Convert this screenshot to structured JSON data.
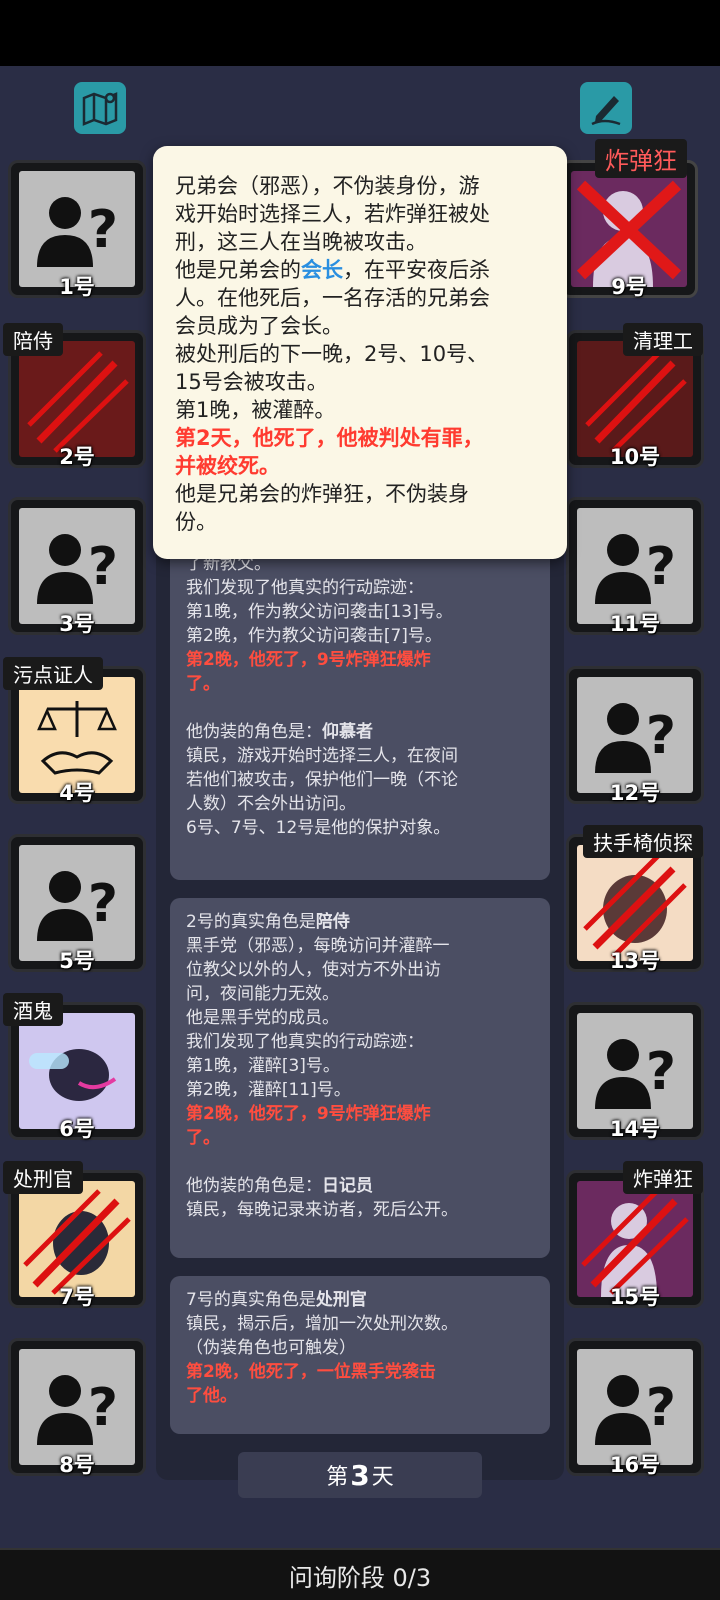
{
  "slots": {
    "s1": {
      "num": "1号"
    },
    "s2": {
      "num": "2号",
      "role": "陪侍"
    },
    "s3": {
      "num": "3号"
    },
    "s4": {
      "num": "4号",
      "role": "污点证人"
    },
    "s5": {
      "num": "5号"
    },
    "s6": {
      "num": "6号",
      "role": "酒鬼"
    },
    "s7": {
      "num": "7号",
      "role": "处刑官"
    },
    "s8": {
      "num": "8号"
    },
    "s9": {
      "num": "9号",
      "role": "炸弹狂"
    },
    "s10": {
      "num": "10号",
      "role": "清理工"
    },
    "s11": {
      "num": "11号"
    },
    "s12": {
      "num": "12号"
    },
    "s13": {
      "num": "13号",
      "role": "扶手椅侦探"
    },
    "s14": {
      "num": "14号"
    },
    "s15": {
      "num": "15号",
      "role": "炸弹狂"
    },
    "s16": {
      "num": "16号"
    }
  },
  "popup": {
    "l1": "兄弟会（邪恶），不伪装身份，游",
    "l2": "戏开始时选择三人，若炸弹狂被处",
    "l3": "刑，这三人在当晚被攻击。",
    "l4a": "他是兄弟会的",
    "l4b": "会长",
    "l4c": "，在平安夜后杀",
    "l5": "人。在他死后，一名存活的兄弟会",
    "l6": "会员成为了会长。",
    "l7": "被处刑后的下一晚，2号、10号、",
    "l8": "15号会被攻击。",
    "l9": "第1晚，被灌醉。",
    "l10": "第2天，他死了，他被判处有罪，",
    "l11": "并被绞死。",
    "l12": "他是兄弟会的炸弹狂，不伪装身",
    "l13": "份。"
  },
  "card1": {
    "l1": "了新教父。",
    "l2": "我们发现了他真实的行动踪迹：",
    "l3": "第1晚，作为教父访问袭击[13]号。",
    "l4": "第2晚，作为教父访问袭击[7]号。",
    "l5": "第2晚，他死了，9号炸弹狂爆炸",
    "l6": "了。",
    "l7a": "他伪装的角色是：",
    "l7b": "仰慕者",
    "l8": "镇民，游戏开始时选择三人，在夜间",
    "l9": "若他们被攻击，保护他们一晚（不论",
    "l10": "人数）不会外出访问。",
    "l11": "6号、7号、12号是他的保护对象。"
  },
  "card2": {
    "l1a": "2号的真实角色是",
    "l1b": "陪侍",
    "l2": "黑手党（邪恶），每晚访问并灌醉一",
    "l3": "位教父以外的人，使对方不外出访",
    "l4": "问，夜间能力无效。",
    "l5": "他是黑手党的成员。",
    "l6": "我们发现了他真实的行动踪迹：",
    "l7": "第1晚，灌醉[3]号。",
    "l8": "第2晚，灌醉[11]号。",
    "l9": "第2晚，他死了，9号炸弹狂爆炸",
    "l10": "了。",
    "l11a": "他伪装的角色是：",
    "l11b": "日记员",
    "l12": "镇民，每晚记录来访者，死后公开。"
  },
  "card3": {
    "l1a": "7号的真实角色是",
    "l1b": "处刑官",
    "l2": "镇民，揭示后，增加一次处刑次数。",
    "l3": "（伪装角色也可触发）",
    "l4": "第2晚，他死了，一位黑手党袭击",
    "l5": "了他。"
  },
  "day": {
    "pre": "第",
    "n": "3",
    "post": "天"
  },
  "phase": "问询阶段 0/3",
  "colors": {
    "accent_teal": "#2a9aa6",
    "danger_red": "#ff3b30",
    "popup_bg": "#fbf7e6"
  },
  "icons": {
    "left_top": "map-icon",
    "right_top": "notes-pen-icon"
  }
}
